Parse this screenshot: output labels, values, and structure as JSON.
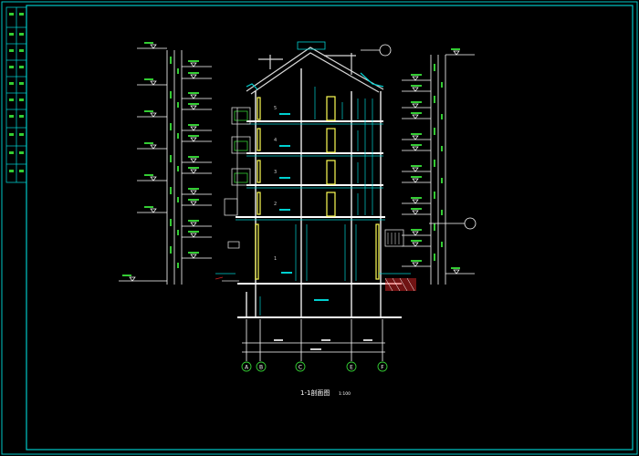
{
  "colors": {
    "background": "#000000",
    "border": "#00c8c8",
    "title": "#ffffff",
    "wall": "#ffffff",
    "roof": "#d8d8d8",
    "cyan": "#00d0d0",
    "yellow": "#ffff55",
    "green": "#33cc33",
    "red": "#cc2222",
    "text": "#cfcfcf"
  },
  "drawing": {
    "title": "1-1剖面图",
    "scale": "1:100"
  },
  "axes": {
    "labels": [
      "A",
      "B",
      "C",
      "E",
      "F"
    ]
  },
  "floors": {
    "labels": [
      "5",
      "4",
      "3",
      "2",
      "1"
    ]
  },
  "icons": {
    "section_marker": "circle-marker-icon",
    "axis_bubble": "axis-bubble-icon",
    "elevation_mark": "elevation-triangle-icon"
  }
}
